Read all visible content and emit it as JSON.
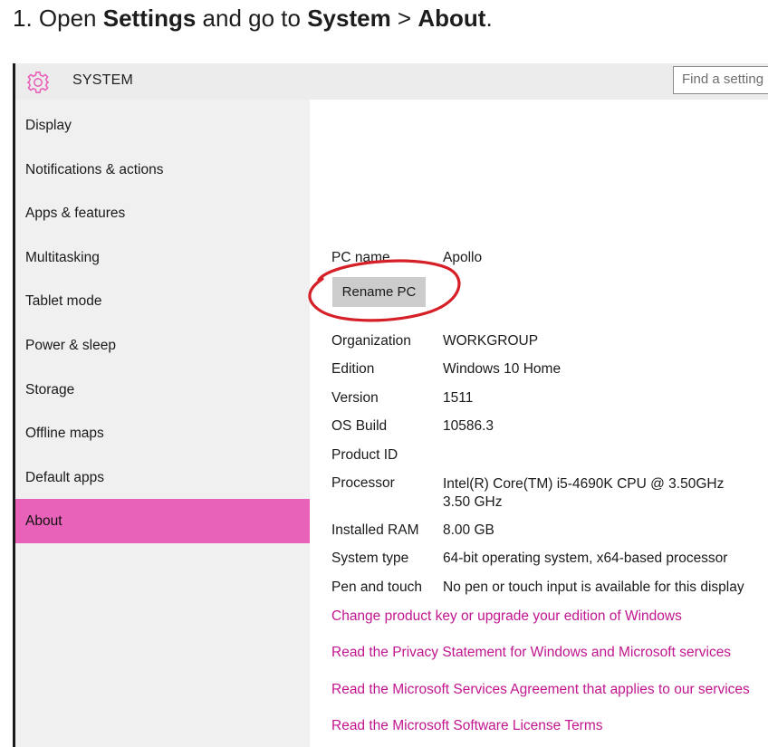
{
  "instruction": {
    "prefix": "1. Open ",
    "settings": "Settings",
    "mid": " and go to ",
    "system": "System",
    "sep": " > ",
    "about": "About",
    "suffix": "."
  },
  "window": {
    "title": "SYSTEM",
    "title_icon": "gear-icon",
    "search_placeholder": "Find a setting"
  },
  "colors": {
    "accent": "#e962b9",
    "link": "#c1168f",
    "annotation_circle": "#d62028"
  },
  "sidebar": {
    "items": [
      {
        "label": "Display"
      },
      {
        "label": "Notifications & actions"
      },
      {
        "label": "Apps & features"
      },
      {
        "label": "Multitasking"
      },
      {
        "label": "Tablet mode"
      },
      {
        "label": "Power & sleep"
      },
      {
        "label": "Storage"
      },
      {
        "label": "Offline maps"
      },
      {
        "label": "Default apps"
      },
      {
        "label": "About",
        "selected": true
      }
    ]
  },
  "about": {
    "pc_name_label": "PC name",
    "pc_name_value": "Apollo",
    "rename_button": "Rename PC",
    "rows": [
      {
        "label": "Organization",
        "value": "WORKGROUP"
      },
      {
        "label": "Edition",
        "value": "Windows 10 Home"
      },
      {
        "label": "Version",
        "value": "1511"
      },
      {
        "label": "OS Build",
        "value": "10586.3"
      },
      {
        "label": "Product ID",
        "value": ""
      },
      {
        "label": "Processor",
        "value": "Intel(R) Core(TM) i5-4690K CPU @ 3.50GHz   3.50 GHz"
      },
      {
        "label": "Installed RAM",
        "value": "8.00 GB"
      },
      {
        "label": "System type",
        "value": "64-bit operating system, x64-based processor"
      },
      {
        "label": "Pen and touch",
        "value": "No pen or touch input is available for this display"
      }
    ],
    "links": [
      "Change product key or upgrade your edition of Windows",
      "Read the Privacy Statement for Windows and Microsoft services",
      "Read the Microsoft Services Agreement that applies to our services",
      "Read the Microsoft Software License Terms"
    ]
  }
}
